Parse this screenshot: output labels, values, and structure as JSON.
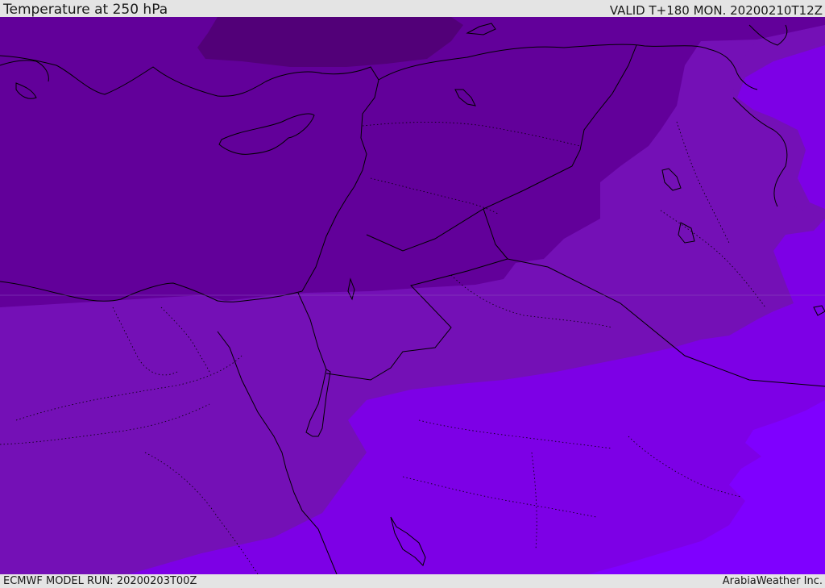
{
  "header": {
    "title": "Temperature at 250 hPa",
    "valid": "VALID T+180 MON. 20200210T12Z"
  },
  "footer": {
    "model_run": "ECMWF MODEL RUN: 20200203T00Z",
    "credit": "ArabiaWeather Inc."
  },
  "map": {
    "fill_colors": {
      "darkest": "#520078",
      "dark": "#62009a",
      "medium": "#7410b6",
      "light": "#7d00e6",
      "lightest": "#7f00ff"
    },
    "line_color": "#000000"
  }
}
